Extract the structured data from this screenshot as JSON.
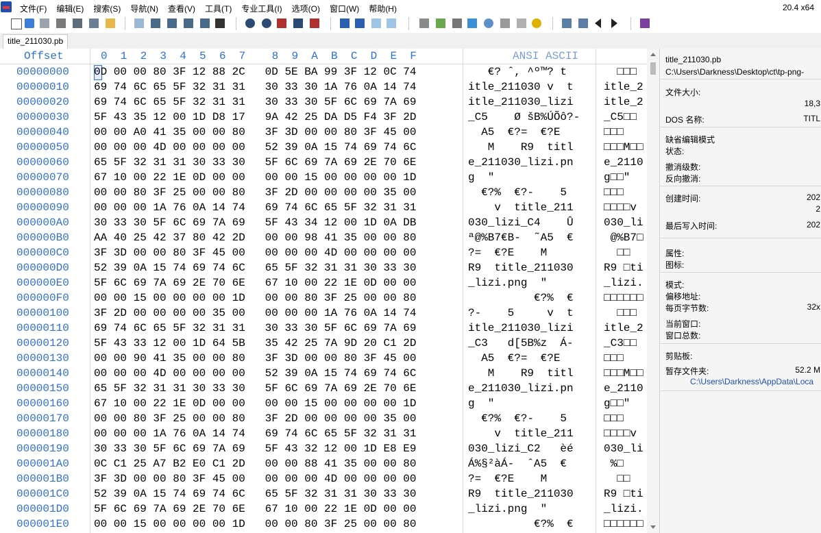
{
  "app": {
    "version": "20.4 x64"
  },
  "menu": {
    "items": [
      "文件(F)",
      "编辑(E)",
      "搜索(S)",
      "导航(N)",
      "查看(V)",
      "工具(T)",
      "专业工具(I)",
      "选项(O)",
      "窗口(W)",
      "帮助(H)"
    ]
  },
  "toolbar": {
    "icons": [
      "new-file-icon",
      "open-file-icon",
      "save-icon",
      "print-icon",
      "properties-icon",
      "undo-icon",
      "copy-icon",
      "paste-icon",
      "find-icon",
      "replace-icon",
      "goto-icon",
      "back-icon",
      "forward-icon",
      "disk-icon",
      "ram-icon",
      "calculator-icon",
      "search-icon",
      "hash-icon",
      "settings-icon",
      "bookmark-icon"
    ]
  },
  "tab": {
    "label": "title_211030.pb"
  },
  "editor": {
    "offset_header": "Offset",
    "hex_header": "0  1  2  3  4  5  6  7    8  9  A  B  C  D  E  F",
    "ascii_header": "ANSI ASCII",
    "rows": [
      {
        "offset": "00000000",
        "hex": "0D 00 00 80 3F 12 88 2C   0D 5E BA 99 3F 12 0C 74",
        "ascii": "   €? ˆ, ^º™? t",
        "unicode": "  □□□"
      },
      {
        "offset": "00000010",
        "hex": "69 74 6C 65 5F 32 31 31   30 33 30 1A 76 0A 14 74",
        "ascii": "itle_211030 v  t",
        "unicode": "itle_2"
      },
      {
        "offset": "00000020",
        "hex": "69 74 6C 65 5F 32 31 31   30 33 30 5F 6C 69 7A 69",
        "ascii": "itle_211030_lizi",
        "unicode": "itle_2"
      },
      {
        "offset": "00000030",
        "hex": "5F 43 35 12 00 1D D8 17   9A 42 25 DA D5 F4 3F 2D",
        "ascii": "_C5    Ø šB%ÚÕô?-",
        "unicode": "_C5□□"
      },
      {
        "offset": "00000040",
        "hex": "00 00 A0 41 35 00 00 80   3F 3D 00 00 80 3F 45 00",
        "ascii": "  A5  €?=  €?E",
        "unicode": "□□□"
      },
      {
        "offset": "00000050",
        "hex": "00 00 00 4D 00 00 00 00   52 39 0A 15 74 69 74 6C",
        "ascii": "   M    R9  titl",
        "unicode": "□□□M□□"
      },
      {
        "offset": "00000060",
        "hex": "65 5F 32 31 31 30 33 30   5F 6C 69 7A 69 2E 70 6E",
        "ascii": "e_211030_lizi.pn",
        "unicode": "e_2110"
      },
      {
        "offset": "00000070",
        "hex": "67 10 00 22 1E 0D 00 00   00 00 15 00 00 00 00 1D",
        "ascii": "g  \"",
        "unicode": "g□□\""
      },
      {
        "offset": "00000080",
        "hex": "00 00 80 3F 25 00 00 80   3F 2D 00 00 00 00 35 00",
        "ascii": "  €?%  €?-    5",
        "unicode": "□□□"
      },
      {
        "offset": "00000090",
        "hex": "00 00 00 1A 76 0A 14 74   69 74 6C 65 5F 32 31 31",
        "ascii": "    v  title_211",
        "unicode": "□□□□v"
      },
      {
        "offset": "000000A0",
        "hex": "30 33 30 5F 6C 69 7A 69   5F 43 34 12 00 1D 0A DB",
        "ascii": "030_lizi_C4    Û",
        "unicode": "030_li"
      },
      {
        "offset": "000000B0",
        "hex": "AA 40 25 42 37 80 42 2D   00 00 98 41 35 00 00 80",
        "ascii": "ª@%B7€B-  ˜A5  €",
        "unicode": " @%B7□"
      },
      {
        "offset": "000000C0",
        "hex": "3F 3D 00 00 80 3F 45 00   00 00 00 4D 00 00 00 00",
        "ascii": "?=  €?E    M",
        "unicode": "  □□"
      },
      {
        "offset": "000000D0",
        "hex": "52 39 0A 15 74 69 74 6C   65 5F 32 31 31 30 33 30",
        "ascii": "R9  title_211030",
        "unicode": "R9 □ti"
      },
      {
        "offset": "000000E0",
        "hex": "5F 6C 69 7A 69 2E 70 6E   67 10 00 22 1E 0D 00 00",
        "ascii": "_lizi.png  \"",
        "unicode": "_lizi."
      },
      {
        "offset": "000000F0",
        "hex": "00 00 15 00 00 00 00 1D   00 00 80 3F 25 00 00 80",
        "ascii": "          €?%  €",
        "unicode": "□□□□□□"
      },
      {
        "offset": "00000100",
        "hex": "3F 2D 00 00 00 00 35 00   00 00 00 1A 76 0A 14 74",
        "ascii": "?-    5     v  t",
        "unicode": "  □□□"
      },
      {
        "offset": "00000110",
        "hex": "69 74 6C 65 5F 32 31 31   30 33 30 5F 6C 69 7A 69",
        "ascii": "itle_211030_lizi",
        "unicode": "itle_2"
      },
      {
        "offset": "00000120",
        "hex": "5F 43 33 12 00 1D 64 5B   35 42 25 7A 9D 20 C1 2D",
        "ascii": "_C3   d[5B%z  Á-",
        "unicode": "_C3□□"
      },
      {
        "offset": "00000130",
        "hex": "00 00 90 41 35 00 00 80   3F 3D 00 00 80 3F 45 00",
        "ascii": "  A5  €?=  €?E",
        "unicode": "□□□"
      },
      {
        "offset": "00000140",
        "hex": "00 00 00 4D 00 00 00 00   52 39 0A 15 74 69 74 6C",
        "ascii": "   M    R9  titl",
        "unicode": "□□□M□□"
      },
      {
        "offset": "00000150",
        "hex": "65 5F 32 31 31 30 33 30   5F 6C 69 7A 69 2E 70 6E",
        "ascii": "e_211030_lizi.pn",
        "unicode": "e_2110"
      },
      {
        "offset": "00000160",
        "hex": "67 10 00 22 1E 0D 00 00   00 00 15 00 00 00 00 1D",
        "ascii": "g  \"",
        "unicode": "g□□\""
      },
      {
        "offset": "00000170",
        "hex": "00 00 80 3F 25 00 00 80   3F 2D 00 00 00 00 35 00",
        "ascii": "  €?%  €?-    5",
        "unicode": "□□□"
      },
      {
        "offset": "00000180",
        "hex": "00 00 00 1A 76 0A 14 74   69 74 6C 65 5F 32 31 31",
        "ascii": "    v  title_211",
        "unicode": "□□□□v"
      },
      {
        "offset": "00000190",
        "hex": "30 33 30 5F 6C 69 7A 69   5F 43 32 12 00 1D E8 E9",
        "ascii": "030_lizi_C2   èé",
        "unicode": "030_li"
      },
      {
        "offset": "000001A0",
        "hex": "0C C1 25 A7 B2 E0 C1 2D   00 00 88 41 35 00 00 80",
        "ascii": "Á%§²àÁ-  ˆA5  €",
        "unicode": " %□"
      },
      {
        "offset": "000001B0",
        "hex": "3F 3D 00 00 80 3F 45 00   00 00 00 4D 00 00 00 00",
        "ascii": "?=  €?E    M",
        "unicode": "  □□"
      },
      {
        "offset": "000001C0",
        "hex": "52 39 0A 15 74 69 74 6C   65 5F 32 31 31 30 33 30",
        "ascii": "R9  title_211030",
        "unicode": "R9 □ti"
      },
      {
        "offset": "000001D0",
        "hex": "5F 6C 69 7A 69 2E 70 6E   67 10 00 22 1E 0D 00 00",
        "ascii": "_lizi.png  \"",
        "unicode": "_lizi."
      },
      {
        "offset": "000001E0",
        "hex": "00 00 15 00 00 00 00 1D   00 00 80 3F 25 00 00 80",
        "ascii": "          €?%  €",
        "unicode": "□□□□□□"
      }
    ]
  },
  "info_panel": {
    "filename": "title_211030.pb",
    "path": "C:\\Users\\Darkness\\Desktop\\ct\\tp-png-",
    "file_size_label": "文件大小:",
    "file_size_value": "18,3",
    "dos_name_label": "DOS 名称:",
    "dos_name_value": "TITL",
    "edit_mode_label": "缺省编辑模式",
    "state_label": "状态:",
    "undo_level_label": "撤消级数:",
    "undo_reverse_label": "反向撤消:",
    "undo_reverse_value": "",
    "created_label": "创建时间:",
    "created_value": "202",
    "created_value2": "2",
    "modified_label": "最后写入时间:",
    "modified_value": "202",
    "attributes_label": "属性:",
    "icon_label": "图标:",
    "mode_label": "模式:",
    "offset_addr_label": "偏移地址:",
    "bytes_per_page_label": "每页字节数:",
    "bytes_per_page_value": "32x",
    "current_window_label": "当前窗口:",
    "window_total_label": "窗口总数:",
    "clipboard_label": "剪贴板:",
    "temp_folder_label": "暂存文件夹:",
    "temp_folder_value": "52.2 M",
    "temp_folder_path": "C:\\Users\\Darkness\\AppData\\Loca"
  }
}
